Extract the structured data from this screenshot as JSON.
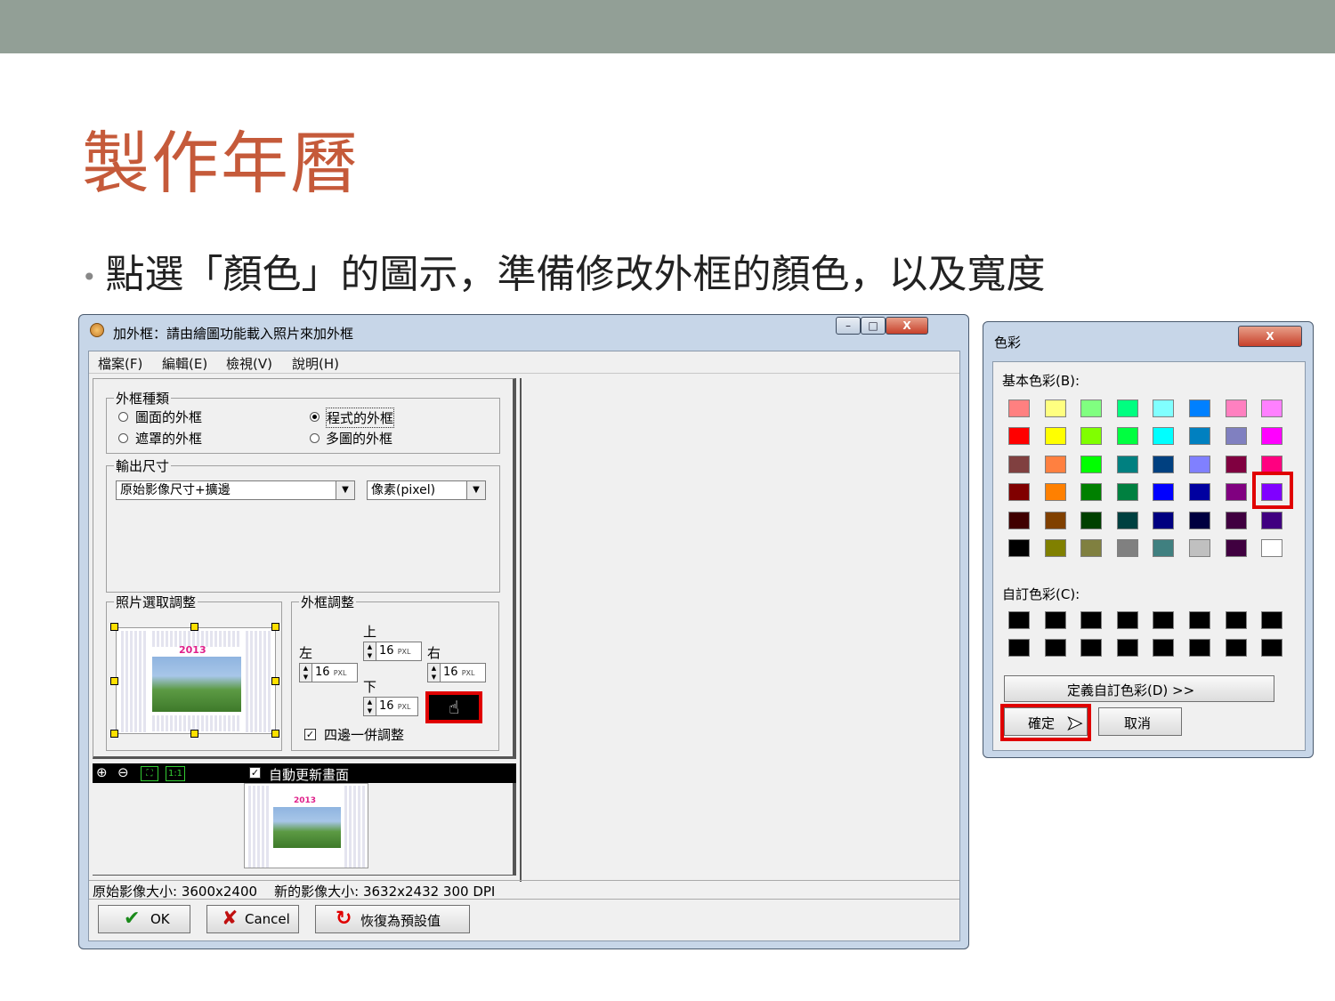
{
  "slide": {
    "title": "製作年曆",
    "bullet": "點選「顏色」的圖示，準備修改外框的顏色，以及寬度"
  },
  "main_window": {
    "title": "加外框：請由繪圖功能載入照片來加外框",
    "caption_buttons": [
      "–",
      "□",
      "X"
    ],
    "menu": [
      "檔案(F)",
      "編輯(E)",
      "檢視(V)",
      "說明(H)"
    ],
    "frame_type": {
      "group_label": "外框種類",
      "options": [
        "圖面的外框",
        "程式的外框",
        "遮罩的外框",
        "多圖的外框"
      ],
      "selected": "程式的外框"
    },
    "output_size": {
      "group_label": "輸出尺寸",
      "size_value": "原始影像尺寸+擴邊",
      "unit_value": "像素(pixel)"
    },
    "photo_adjust": {
      "group_label": "照片選取調整",
      "year": "2013"
    },
    "frame_adjust": {
      "group_label": "外框調整",
      "top_label": "上",
      "left_label": "左",
      "right_label": "右",
      "bottom_label": "下",
      "top_value": "16",
      "left_value": "16",
      "right_value": "16",
      "bottom_value": "16",
      "unit": "PXL",
      "all_sides_label": "四邊一併調整",
      "color_swatch": "#000000"
    },
    "preview": {
      "auto_update_label": "自動更新畫面",
      "zoom_fit": "1:1",
      "year": "2013"
    },
    "status": "原始影像大小: 3600x2400    新的影像大小: 3632x2432 300 DPI",
    "buttons": {
      "ok": "OK",
      "cancel": "Cancel",
      "restore": "恢復為預設值"
    }
  },
  "color_dialog": {
    "title": "色彩",
    "close": "X",
    "basic_label": "基本色彩(B):",
    "basic_colors": [
      "#ff8080",
      "#ffff80",
      "#80ff80",
      "#00ff80",
      "#80ffff",
      "#0080ff",
      "#ff80c0",
      "#ff80ff",
      "#ff0000",
      "#ffff00",
      "#80ff00",
      "#00ff40",
      "#00ffff",
      "#0080c0",
      "#8080c0",
      "#ff00ff",
      "#804040",
      "#ff8040",
      "#00ff00",
      "#008080",
      "#004080",
      "#8080ff",
      "#800040",
      "#ff0080",
      "#800000",
      "#ff8000",
      "#008000",
      "#008040",
      "#0000ff",
      "#0000a0",
      "#800080",
      "#8000ff",
      "#400000",
      "#804000",
      "#004000",
      "#004040",
      "#000080",
      "#000040",
      "#400040",
      "#400080",
      "#000000",
      "#808000",
      "#808040",
      "#808080",
      "#408080",
      "#c0c0c0",
      "#400040",
      "#ffffff"
    ],
    "selected_color": "#8000ff",
    "custom_label": "自訂色彩(C):",
    "custom_colors": [
      "#000000",
      "#000000",
      "#000000",
      "#000000",
      "#000000",
      "#000000",
      "#000000",
      "#000000",
      "#000000",
      "#000000",
      "#000000",
      "#000000",
      "#000000",
      "#000000",
      "#000000",
      "#000000"
    ],
    "define_custom": "定義自訂色彩(D) >>",
    "ok": "確定",
    "cancel": "取消"
  },
  "colors": {
    "title_accent": "#c55a3a",
    "highlight": "#e00000",
    "topbar": "#929f96"
  }
}
